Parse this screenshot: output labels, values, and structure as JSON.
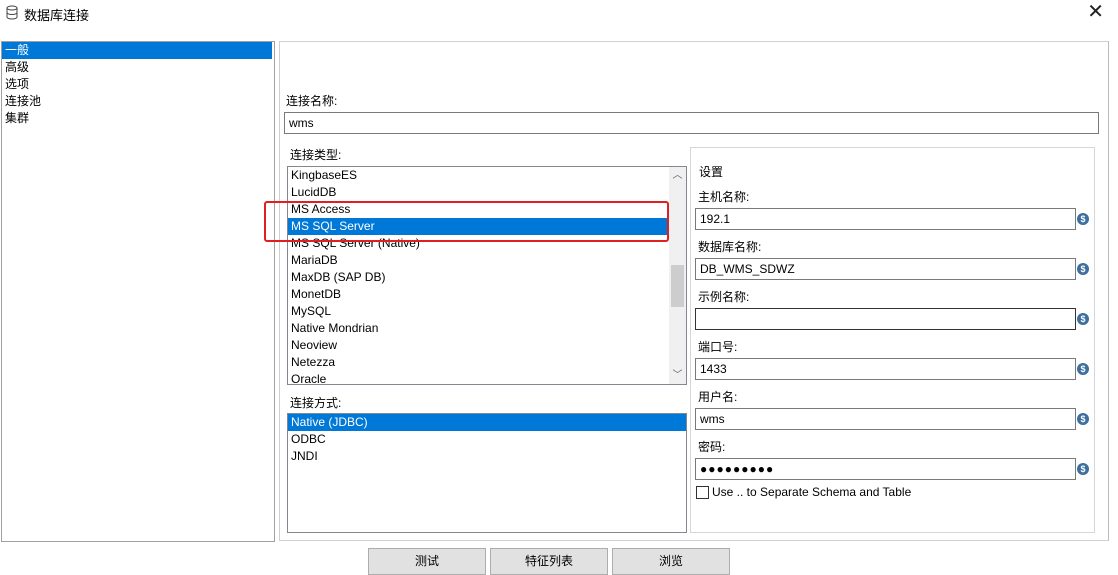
{
  "window": {
    "title": "数据库连接",
    "close_symbol": "✕"
  },
  "sidebar": {
    "items": [
      {
        "label": "一般",
        "selected": true
      },
      {
        "label": "高级",
        "selected": false
      },
      {
        "label": "选项",
        "selected": false
      },
      {
        "label": "连接池",
        "selected": false
      },
      {
        "label": "集群",
        "selected": false
      }
    ]
  },
  "general": {
    "connection_name_label": "连接名称:",
    "connection_name_value": "wms",
    "connection_type_label": "连接类型:",
    "connection_types": [
      "KingbaseES",
      "LucidDB",
      "MS Access",
      "MS SQL Server",
      "MS SQL Server (Native)",
      "MariaDB",
      "MaxDB (SAP DB)",
      "MonetDB",
      "MySQL",
      "Native Mondrian",
      "Neoview",
      "Netezza",
      "Oracle"
    ],
    "connection_type_selected": "MS SQL Server",
    "access_label": "连接方式:",
    "access_methods": [
      "Native (JDBC)",
      "ODBC",
      "JNDI"
    ],
    "access_selected": "Native (JDBC)"
  },
  "settings": {
    "heading": "设置",
    "host_label": "主机名称:",
    "host_value": "192.1",
    "db_label": "数据库名称:",
    "db_value": "DB_WMS_SDWZ",
    "instance_label": "示例名称:",
    "instance_value": "",
    "port_label": "端口号:",
    "port_value": "1433",
    "user_label": "用户名:",
    "user_value": "wms",
    "password_label": "密码:",
    "password_value": "●●●●●●●●●",
    "separator_checkbox_label": "Use .. to Separate Schema and Table",
    "separator_checked": false,
    "variable_symbol": "$"
  },
  "buttons": {
    "test": "测试",
    "features": "特征列表",
    "explore": "浏览"
  },
  "scroll": {
    "up": "︿",
    "down": "﹀"
  },
  "colors": {
    "selection": "#0078d7",
    "highlight_box": "#e02020"
  }
}
